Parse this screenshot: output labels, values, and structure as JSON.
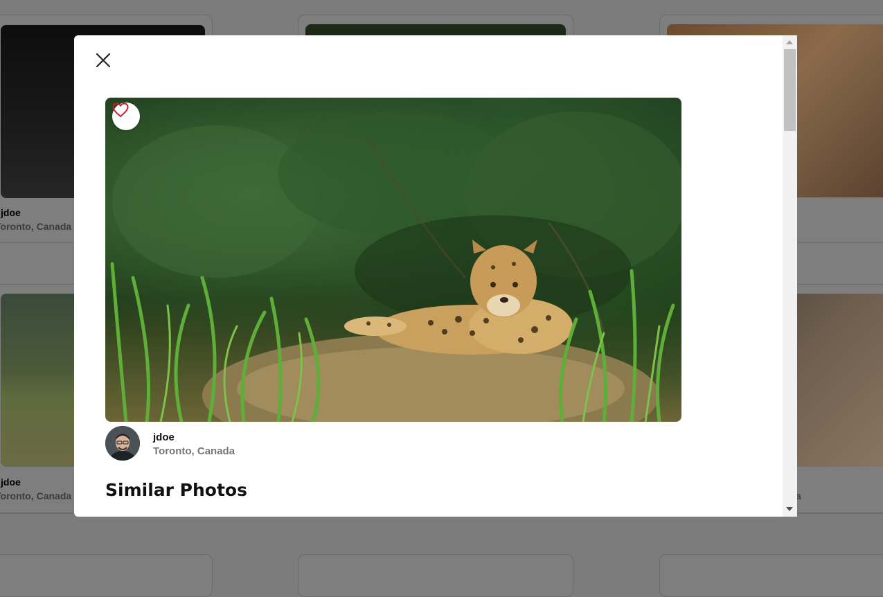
{
  "background_feed": {
    "cards": [
      {
        "user": "jdoe",
        "location": "Toronto, Canada"
      },
      {
        "user": "jdoe",
        "location": "Toronto, Canada"
      },
      {
        "user": "",
        "location": "a"
      }
    ]
  },
  "modal": {
    "close_icon": "close-icon",
    "like_icon": "heart-outline-icon",
    "photo_alt": "Jaguar resting in tall grass",
    "author": {
      "username": "jdoe",
      "location": "Toronto, Canada"
    },
    "similar_title": "Similar Photos"
  },
  "colors": {
    "overlay": "#7c7c7c",
    "modal_bg": "#ffffff",
    "heart": "#cc1f2d",
    "text_primary": "#111111",
    "text_secondary": "#777777"
  }
}
